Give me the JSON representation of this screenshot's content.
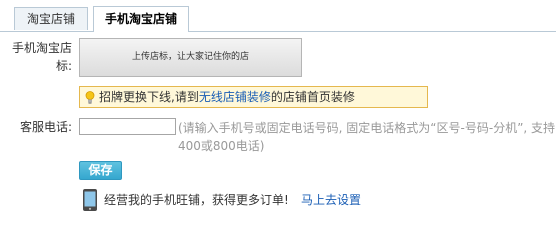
{
  "tabs": [
    {
      "label": "淘宝店铺",
      "active": false
    },
    {
      "label": "手机淘宝店铺",
      "active": true
    }
  ],
  "form": {
    "logo_label": "手机淘宝店标:",
    "upload_text": "上传店标，让大家记住你的店",
    "notice": {
      "prefix": "招牌更换下线,请到",
      "link": "无线店铺装修",
      "suffix": "的店铺首页装修"
    },
    "phone_label": "客服电话:",
    "phone_value": "",
    "phone_hint_line1": "(请输入手机号或固定电话号码, 固定电话格式为“区号-号码-分机”, 支持",
    "phone_hint_line2": "400或800电话)",
    "save_label": "保存"
  },
  "promo": {
    "text": "经营我的手机旺铺，获得更多订单!",
    "link": "马上去设置"
  },
  "colors": {
    "link": "#1a5eb5",
    "save_button": "#35a7cf",
    "notice_border": "#e5b84e",
    "notice_bg": "#fff8d9"
  },
  "icons": [
    "lightbulb-icon",
    "mobile-phone-icon"
  ]
}
